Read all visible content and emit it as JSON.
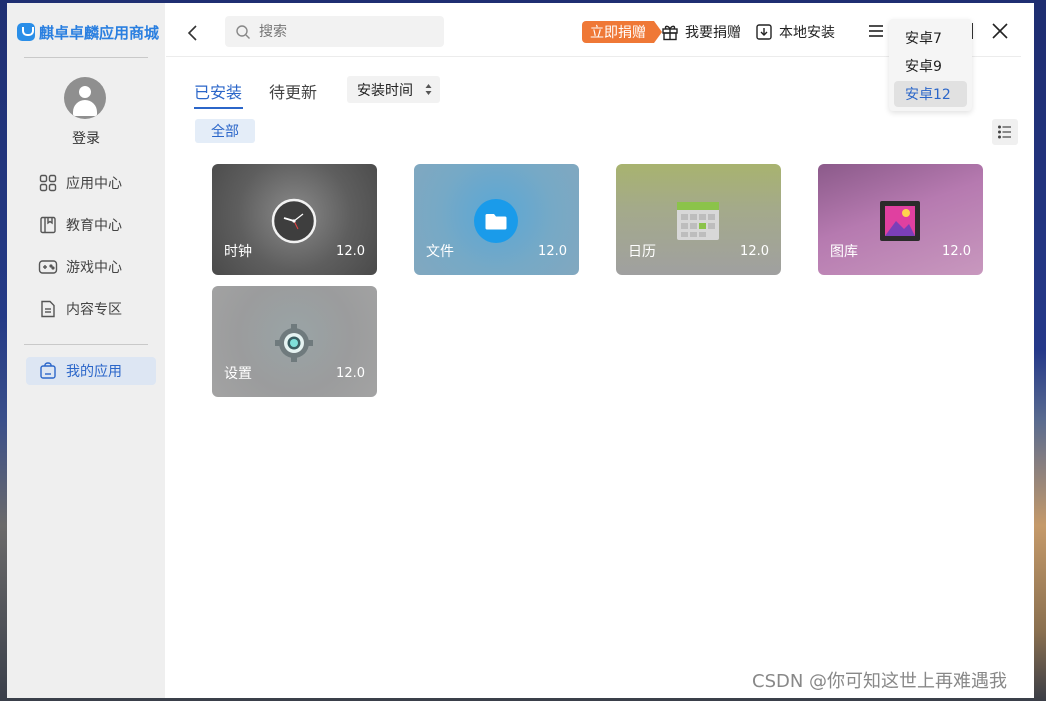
{
  "app": {
    "logo_text": "麒卓卓麟应用商城"
  },
  "sidebar": {
    "login_label": "登录",
    "items": [
      {
        "label": "应用中心",
        "icon": "grid-icon"
      },
      {
        "label": "教育中心",
        "icon": "book-icon"
      },
      {
        "label": "游戏中心",
        "icon": "gamepad-icon"
      },
      {
        "label": "内容专区",
        "icon": "document-icon"
      },
      {
        "label": "我的应用",
        "icon": "bag-icon",
        "active": true
      }
    ]
  },
  "header": {
    "search_placeholder": "搜索",
    "donate_now": "立即捐赠",
    "donate_label": "我要捐赠",
    "local_install_label": "本地安装"
  },
  "android_menu": {
    "options": [
      "安卓7",
      "安卓9",
      "安卓12"
    ],
    "selected": "安卓12"
  },
  "tabs": {
    "installed": "已安装",
    "pending_update": "待更新",
    "sort_label": "安装时间"
  },
  "filter": {
    "all_label": "全部"
  },
  "apps": [
    {
      "name": "时钟",
      "version": "12.0",
      "icon": "clock-icon"
    },
    {
      "name": "文件",
      "version": "12.0",
      "icon": "folder-icon"
    },
    {
      "name": "日历",
      "version": "12.0",
      "icon": "calendar-icon"
    },
    {
      "name": "图库",
      "version": "12.0",
      "icon": "gallery-icon"
    },
    {
      "name": "设置",
      "version": "12.0",
      "icon": "settings-icon"
    }
  ],
  "colors": {
    "accent": "#2b66c9",
    "donate": "#ef7836",
    "sidebar_bg": "#efefef"
  },
  "watermark": "CSDN @你可知这世上再难遇我"
}
